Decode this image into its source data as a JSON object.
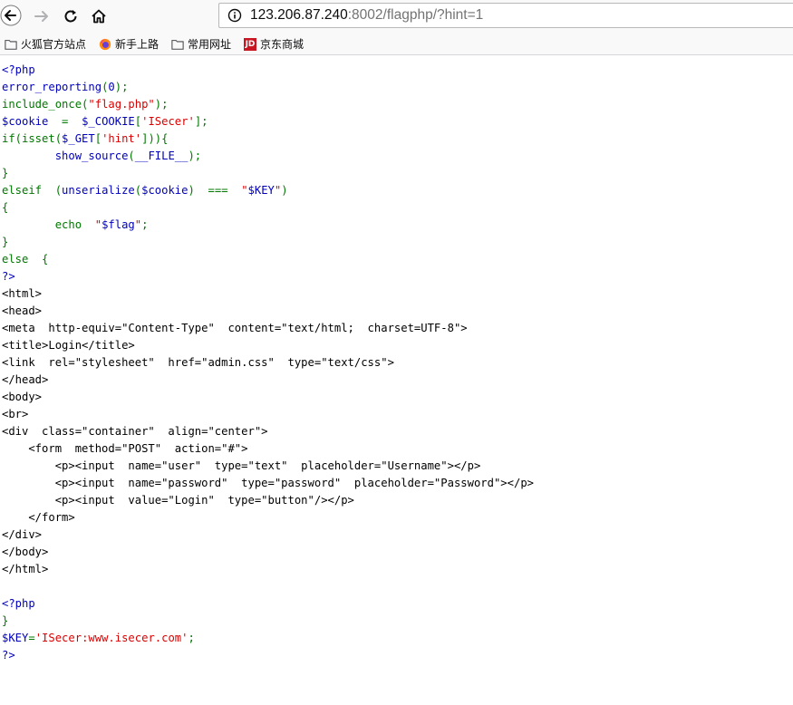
{
  "browser": {
    "url_host": "123.206.87.240",
    "url_rest": ":8002/flagphp/?hint=1",
    "bookmarks": [
      {
        "label": "火狐官方站点"
      },
      {
        "label": "新手上路"
      },
      {
        "label": "常用网址"
      },
      {
        "label": "京东商城",
        "badge": "JD"
      }
    ]
  },
  "colors": {
    "php_keyword": "#0000bb",
    "php_default": "#007700",
    "php_string": "#dd0000",
    "html": "#000000"
  },
  "code_lines": [
    [
      {
        "t": "<?php",
        "c": "c-blue"
      }
    ],
    [
      {
        "t": "error_reporting",
        "c": "c-blue"
      },
      {
        "t": "(",
        "c": "c-green"
      },
      {
        "t": "0",
        "c": "c-blue"
      },
      {
        "t": ");",
        "c": "c-green"
      }
    ],
    [
      {
        "t": "include_once(",
        "c": "c-green"
      },
      {
        "t": "\"flag.php\"",
        "c": "c-red"
      },
      {
        "t": ");",
        "c": "c-green"
      }
    ],
    [
      {
        "t": "$cookie  ",
        "c": "c-blue"
      },
      {
        "t": "=  ",
        "c": "c-green"
      },
      {
        "t": "$_COOKIE",
        "c": "c-blue"
      },
      {
        "t": "[",
        "c": "c-green"
      },
      {
        "t": "'ISecer'",
        "c": "c-red"
      },
      {
        "t": "];",
        "c": "c-green"
      }
    ],
    [
      {
        "t": "if(isset(",
        "c": "c-green"
      },
      {
        "t": "$_GET",
        "c": "c-blue"
      },
      {
        "t": "[",
        "c": "c-green"
      },
      {
        "t": "'hint'",
        "c": "c-red"
      },
      {
        "t": "])){",
        "c": "c-green"
      }
    ],
    [
      {
        "t": "        ",
        "c": "c-green"
      },
      {
        "t": "show_source",
        "c": "c-blue"
      },
      {
        "t": "(",
        "c": "c-green"
      },
      {
        "t": "__FILE__",
        "c": "c-blue"
      },
      {
        "t": ");",
        "c": "c-green"
      }
    ],
    [
      {
        "t": "}",
        "c": "c-green"
      }
    ],
    [
      {
        "t": "elseif  (",
        "c": "c-green"
      },
      {
        "t": "unserialize",
        "c": "c-blue"
      },
      {
        "t": "(",
        "c": "c-green"
      },
      {
        "t": "$cookie",
        "c": "c-blue"
      },
      {
        "t": ")  ===  ",
        "c": "c-green"
      },
      {
        "t": "\"",
        "c": "c-red"
      },
      {
        "t": "$KEY",
        "c": "c-blue"
      },
      {
        "t": "\"",
        "c": "c-red"
      },
      {
        "t": ")",
        "c": "c-green"
      }
    ],
    [
      {
        "t": "{",
        "c": "c-green"
      }
    ],
    [
      {
        "t": "        echo  ",
        "c": "c-green"
      },
      {
        "t": "\"",
        "c": "c-red"
      },
      {
        "t": "$flag",
        "c": "c-blue"
      },
      {
        "t": "\"",
        "c": "c-red"
      },
      {
        "t": ";",
        "c": "c-green"
      }
    ],
    [
      {
        "t": "}",
        "c": "c-green"
      }
    ],
    [
      {
        "t": "else  {",
        "c": "c-green"
      }
    ],
    [
      {
        "t": "?>",
        "c": "c-blue"
      }
    ],
    [
      {
        "t": "<html>",
        "c": "c-black"
      }
    ],
    [
      {
        "t": "<head>",
        "c": "c-black"
      }
    ],
    [
      {
        "t": "<meta  http-equiv=\"Content-Type\"  content=\"text/html;  charset=UTF-8\">",
        "c": "c-black"
      }
    ],
    [
      {
        "t": "<title>Login</title>",
        "c": "c-black"
      }
    ],
    [
      {
        "t": "<link  rel=\"stylesheet\"  href=\"admin.css\"  type=\"text/css\">",
        "c": "c-black"
      }
    ],
    [
      {
        "t": "</head>",
        "c": "c-black"
      }
    ],
    [
      {
        "t": "<body>",
        "c": "c-black"
      }
    ],
    [
      {
        "t": "<br>",
        "c": "c-black"
      }
    ],
    [
      {
        "t": "<div  class=\"container\"  align=\"center\">",
        "c": "c-black"
      }
    ],
    [
      {
        "t": "    <form  method=\"POST\"  action=\"#\">",
        "c": "c-black"
      }
    ],
    [
      {
        "t": "        <p><input  name=\"user\"  type=\"text\"  placeholder=\"Username\"></p>",
        "c": "c-black"
      }
    ],
    [
      {
        "t": "        <p><input  name=\"password\"  type=\"password\"  placeholder=\"Password\"></p>",
        "c": "c-black"
      }
    ],
    [
      {
        "t": "        <p><input  value=\"Login\"  type=\"button\"/></p>",
        "c": "c-black"
      }
    ],
    [
      {
        "t": "    </form>",
        "c": "c-black"
      }
    ],
    [
      {
        "t": "</div>",
        "c": "c-black"
      }
    ],
    [
      {
        "t": "</body>",
        "c": "c-black"
      }
    ],
    [
      {
        "t": "</html>",
        "c": "c-black"
      }
    ],
    [],
    [
      {
        "t": "<?php",
        "c": "c-blue"
      }
    ],
    [
      {
        "t": "}",
        "c": "c-green"
      }
    ],
    [
      {
        "t": "$KEY",
        "c": "c-blue"
      },
      {
        "t": "=",
        "c": "c-green"
      },
      {
        "t": "'ISecer:www.isecer.com'",
        "c": "c-red"
      },
      {
        "t": ";",
        "c": "c-green"
      }
    ],
    [
      {
        "t": "?>",
        "c": "c-blue"
      }
    ]
  ]
}
